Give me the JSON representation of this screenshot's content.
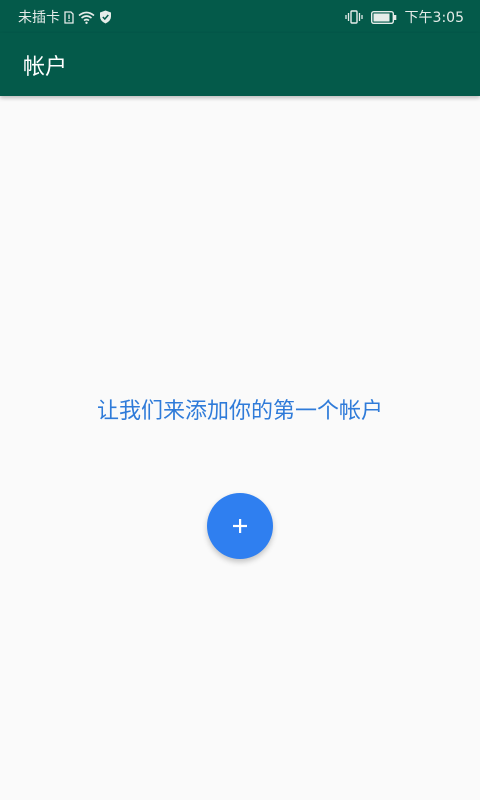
{
  "status_bar": {
    "carrier": "未插卡",
    "time": "下午3:05"
  },
  "app_bar": {
    "title": "帐户"
  },
  "empty_state": {
    "message": "让我们来添加你的第一个帐户"
  },
  "fab": {
    "icon": "plus-icon"
  },
  "colors": {
    "primary": "#045a4a",
    "accent": "#2f7ff0",
    "message_text": "#2f7bd9",
    "background": "#fafafa"
  }
}
